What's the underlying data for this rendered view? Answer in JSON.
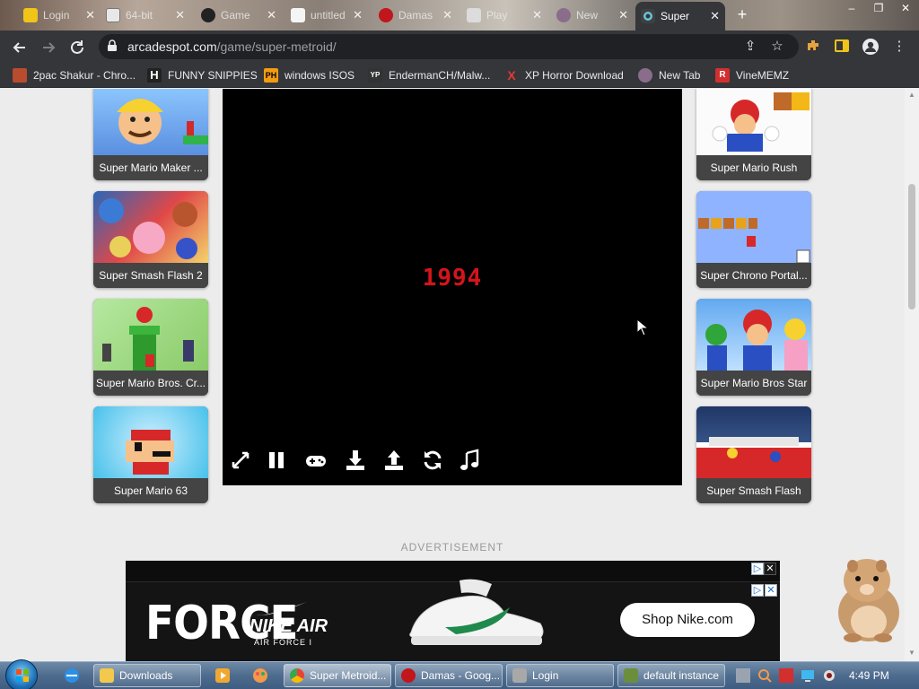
{
  "browser": {
    "tabs": [
      {
        "label": "Login",
        "icon": "chrome-favicon"
      },
      {
        "label": "64-bit",
        "icon": "image-favicon"
      },
      {
        "label": "Game",
        "icon": "gear-favicon"
      },
      {
        "label": "untitled",
        "icon": "document-favicon"
      },
      {
        "label": "Damas",
        "icon": "red-circle-favicon"
      },
      {
        "label": "Play",
        "icon": "controller-favicon"
      },
      {
        "label": "New",
        "icon": "globe-favicon"
      },
      {
        "label": "Super",
        "icon": "arcadespot-favicon",
        "active": true
      }
    ],
    "url_host": "arcadespot.com",
    "url_path": "/game/super-metroid/",
    "bookmarks": [
      {
        "label": "2pac Shakur - Chro...",
        "icon_text": "",
        "color": "#b94b2e"
      },
      {
        "label": "FUNNY SNIPPIES",
        "icon_text": "H",
        "color": "#222222"
      },
      {
        "label": "windows ISOS",
        "icon_text": "PH",
        "color": "#f39c12"
      },
      {
        "label": "EndermanCH/Malw...",
        "icon_text": "YP",
        "color": "#333333"
      },
      {
        "label": "XP Horror Download",
        "icon_text": "X",
        "color": "#d32f2f"
      },
      {
        "label": "New Tab",
        "icon_text": "",
        "color": "#8a6d8a"
      },
      {
        "label": "VineMEMZ",
        "icon_text": "R",
        "color": "#d32f2f"
      }
    ]
  },
  "page": {
    "left_games": [
      "Super Mario Maker ...",
      "Super Smash Flash 2",
      "Super Mario Bros. Cr...",
      "Super Mario 63"
    ],
    "right_games": [
      "Super Mario Rush",
      "Super Chrono Portal...",
      "Super Mario Bros Star",
      "Super Smash Flash"
    ],
    "game": {
      "year_text": "1994",
      "controls": [
        "fullscreen-icon",
        "pause-icon",
        "gamepad-icon",
        "download-icon",
        "upload-icon",
        "refresh-icon",
        "music-icon"
      ]
    },
    "ad_label": "ADVERTISEMENT",
    "ad": {
      "force": "FORCE",
      "nike_air": "NIKE AIR",
      "air_force": "AIR FORCE I",
      "cta": "Shop Nike.com"
    }
  },
  "taskbar": {
    "tasks": [
      {
        "label": "Downloads",
        "icon": "folder-icon"
      },
      {
        "label": "Super Metroid...",
        "icon": "chrome-icon",
        "active": true
      },
      {
        "label": "Damas - Goog...",
        "icon": "red-circle-icon"
      },
      {
        "label": "Login",
        "icon": "app-icon"
      },
      {
        "label": "default instance",
        "icon": "cube-icon"
      }
    ],
    "clock": "4:49 PM"
  }
}
